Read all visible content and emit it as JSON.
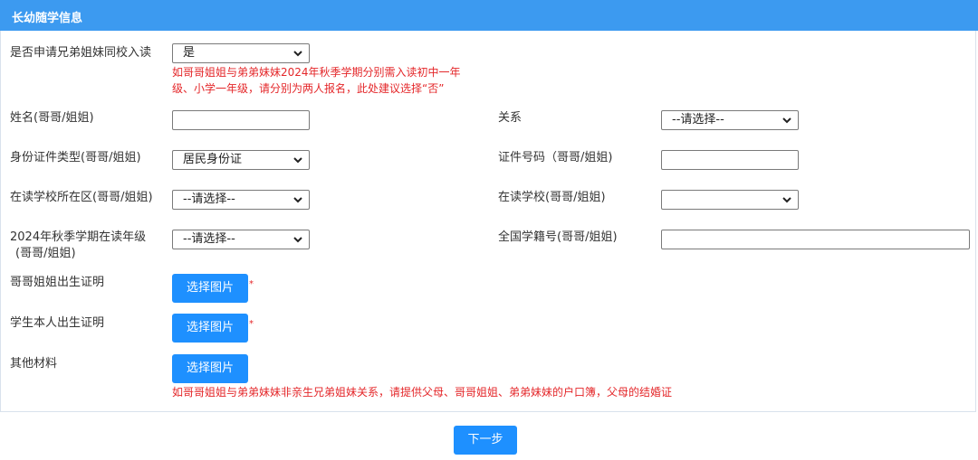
{
  "header": {
    "title": "长幼随学信息"
  },
  "form": {
    "same_school": {
      "label": "是否申请兄弟姐妹同校入读",
      "value": "是",
      "hint_line1": "如哥哥姐姐与弟弟妹妹2024年秋季学期分别需入读初中一年",
      "hint_line2": "级、小学一年级，请分别为两人报名，此处建议选择“否”"
    },
    "sibling_name": {
      "label": "姓名(哥哥/姐姐)",
      "value": ""
    },
    "relation": {
      "label": "关系",
      "value": "--请选择--"
    },
    "id_type": {
      "label": "身份证件类型(哥哥/姐姐)",
      "value": "居民身份证"
    },
    "id_number": {
      "label": "证件号码（哥哥/姐姐)",
      "value": ""
    },
    "school_district": {
      "label": "在读学校所在区(哥哥/姐姐)",
      "value": "--请选择--"
    },
    "school": {
      "label": "在读学校(哥哥/姐姐)",
      "value": ""
    },
    "grade": {
      "label_line1": "2024年秋季学期在读年级",
      "label_line2": "(哥哥/姐姐)",
      "value": "--请选择--"
    },
    "student_id": {
      "label": "全国学籍号(哥哥/姐姐)",
      "value": ""
    },
    "sibling_birth_cert": {
      "label": "哥哥姐姐出生证明",
      "button": "选择图片",
      "required": "*"
    },
    "self_birth_cert": {
      "label": "学生本人出生证明",
      "button": "选择图片",
      "required": "*"
    },
    "other_materials": {
      "label": "其他材料",
      "button": "选择图片",
      "hint": "如哥哥姐姐与弟弟妹妹非亲生兄弟姐妹关系，请提供父母、哥哥姐姐、弟弟妹妹的户口簿，父母的结婚证"
    }
  },
  "footer": {
    "next_button": "下一步"
  },
  "colors": {
    "header": "#3c9af0",
    "button": "#1e90ff",
    "hint": "#e4272a"
  },
  "icons": {
    "dropdown": "chevron-down-icon"
  }
}
